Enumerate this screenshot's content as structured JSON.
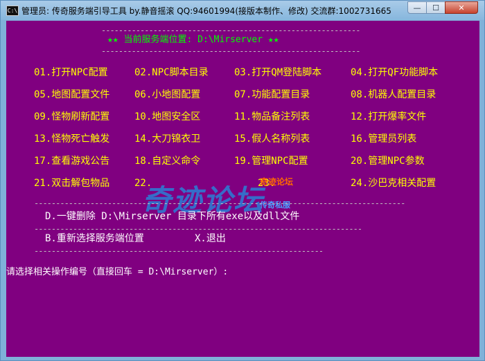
{
  "window": {
    "title": "管理员: 传奇服务端引导工具   by.静音摇滚  QQ:94601994(接版本制作、修改) 交流群:1002731665",
    "icon_text": "C:\\",
    "minimize_label": "—",
    "maximize_label": "☐",
    "close_label": "✕"
  },
  "console": {
    "dash_line_top": "------------------------------------------------------------",
    "header": "★★ 当前服务端位置: D:\\Mirserver ★★",
    "dash_line_header": "------------------------------------------------------------",
    "menu_items": [
      "01.打开NPC配置",
      "02.NPC脚本目录",
      "03.打开QM登陆脚本",
      "04.打开QF功能脚本",
      "05.地图配置文件",
      "06.小地图配置",
      "07.功能配置目录",
      "08.机器人配置目录",
      "09.怪物刷新配置",
      "10.地图安全区",
      "11.物品备注列表",
      "12.打开爆率文件",
      "13.怪物死亡触发",
      "14.大刀锦衣卫",
      "15.假人名称列表",
      "16.管理员列表",
      "17.查看游戏公告",
      "18.自定义命令",
      "19.管理NPC配置",
      "20.管理NPC参数",
      "21.双击解包物品",
      "22.",
      "23.",
      "24.沙巴克相关配置"
    ],
    "dash_line_mid": "--------------------------------------------------------------------------------------",
    "option_delete": "D.一键删除 D:\\Mirserver 目录下所有exe以及dll文件",
    "dash_line_mid2": "----------------------------------------------------------------------------",
    "option_reselect": "B.重新选择服务端位置",
    "option_exit": "X.退出",
    "dash_line_bottom": "-------------------------------------------------------------------",
    "prompt": "请选择相关操作编号（直接回车 = D:\\Mirserver）:"
  },
  "watermark": {
    "main": "奇迹论坛",
    "sub1": "奇迹论坛",
    "sub2": "传奇私服"
  },
  "colors": {
    "console_bg": "#800080",
    "header_green": "#00ff00",
    "item_yellow": "#ffff00",
    "option_white": "#ffffff"
  }
}
